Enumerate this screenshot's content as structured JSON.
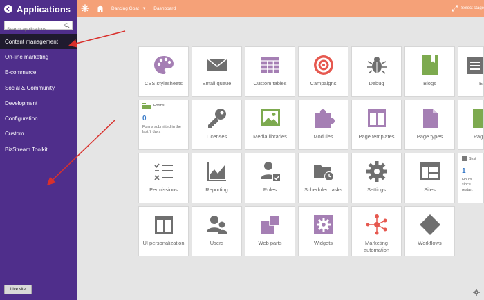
{
  "sidebar": {
    "title": "Applications",
    "search_placeholder": "Search applications...",
    "items": [
      {
        "label": "Content management",
        "active": true
      },
      {
        "label": "On-line marketing"
      },
      {
        "label": "E-commerce"
      },
      {
        "label": "Social & Community"
      },
      {
        "label": "Development"
      },
      {
        "label": "Configuration"
      },
      {
        "label": "Custom"
      },
      {
        "label": "BizStream Toolkit"
      }
    ],
    "live_site": "Live site"
  },
  "topbar": {
    "site": "Dancing Goat",
    "dashboard": "Dashboard",
    "select_stage": "Select stage"
  },
  "widgets": {
    "forms": {
      "title": "Forms",
      "value": "0",
      "text": "Forms submitted in the last 7 days"
    },
    "system": {
      "title": "Syst",
      "value": "1",
      "text": "Hours since restart"
    }
  },
  "tiles": {
    "css": "CSS stylesheets",
    "email_queue": "Email queue",
    "custom_tables": "Custom tables",
    "campaigns": "Campaigns",
    "debug": "Debug",
    "blogs": "Blogs",
    "events": "Event",
    "licenses": "Licenses",
    "media": "Media libraries",
    "modules": "Modules",
    "page_templates": "Page templates",
    "page_types": "Page types",
    "pag": "Pag",
    "permissions": "Permissions",
    "reporting": "Reporting",
    "roles": "Roles",
    "scheduled": "Scheduled tasks",
    "settings": "Settings",
    "sites": "Sites",
    "ui_personalization": "UI personalization",
    "users": "Users",
    "web_parts": "Web parts",
    "widgets": "Widgets",
    "marketing_automation": "Marketing automation",
    "workflows": "Workflows"
  },
  "colors": {
    "sidebar": "#4f2e8b",
    "topbar": "#f5a178",
    "accent_purple": "#a57fb4",
    "accent_gray": "#6f6f6f",
    "accent_green": "#7daa4f",
    "accent_red": "#e6584f",
    "annotation_arrow": "#d9302c"
  }
}
